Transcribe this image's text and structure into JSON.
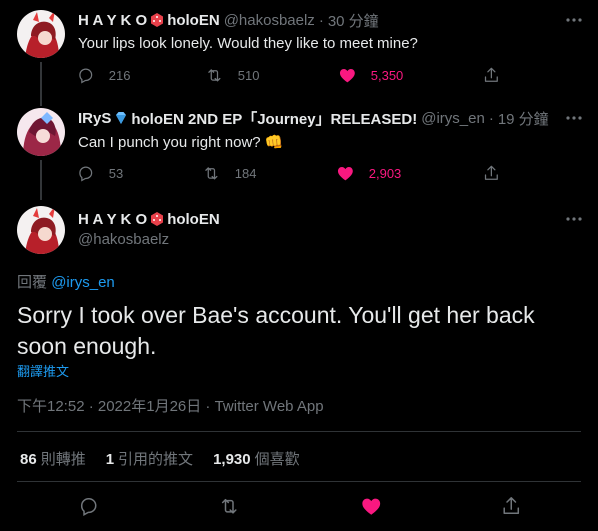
{
  "tweets": [
    {
      "name_pre": "H A Y K O",
      "name_post": "holoEN",
      "handle": "@hakosbaelz",
      "time": "30 分鐘",
      "text": "Your lips look lonely. Would they like to meet mine?",
      "replies": "216",
      "retweets": "510",
      "likes": "5,350",
      "liked": true
    },
    {
      "name_pre": "IRyS",
      "name_post": "holoEN 2ND EP「Journey」RELEASED!",
      "handle": "@irys_en",
      "time": "19 分鐘",
      "text": "Can I punch you right now?",
      "emoji": "👊",
      "replies": "53",
      "retweets": "184",
      "likes": "2,903",
      "liked": true
    }
  ],
  "main": {
    "name_pre": "H A Y K O",
    "name_post": "holoEN",
    "handle": "@hakosbaelz",
    "reply_prefix": "回覆",
    "reply_to": "@irys_en",
    "text": "Sorry I took over Bae's account. You'll get her back soon enough.",
    "translate": "翻譯推文",
    "meta": "下午12:52 · 2022年1月26日 · Twitter Web App",
    "retweets_count": "86",
    "retweets_label": "則轉推",
    "quotes_count": "1",
    "quotes_label": "引用的推文",
    "likes_count": "1,930",
    "likes_label": "個喜歡"
  },
  "colors": {
    "background": "#000000",
    "text": "#e7e9ea",
    "muted": "#71767b",
    "link": "#1d9bf0",
    "like": "#f91880"
  },
  "icons": [
    "reply-icon",
    "retweet-icon",
    "like-icon",
    "share-icon",
    "more-icon",
    "dice-icon",
    "diamond-icon"
  ]
}
